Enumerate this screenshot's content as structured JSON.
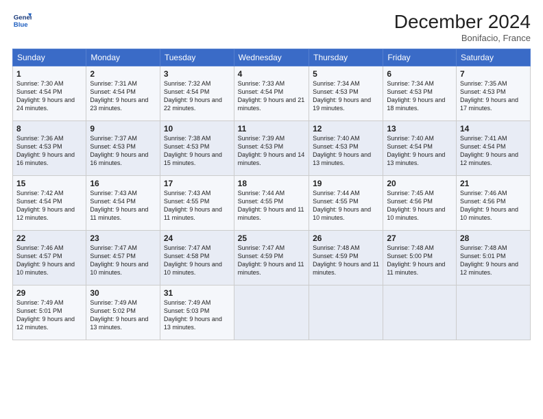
{
  "header": {
    "logo_line1": "General",
    "logo_line2": "Blue",
    "month_title": "December 2024",
    "location": "Bonifacio, France"
  },
  "weekdays": [
    "Sunday",
    "Monday",
    "Tuesday",
    "Wednesday",
    "Thursday",
    "Friday",
    "Saturday"
  ],
  "weeks": [
    [
      {
        "day": "1",
        "sunrise": "Sunrise: 7:30 AM",
        "sunset": "Sunset: 4:54 PM",
        "daylight": "Daylight: 9 hours and 24 minutes."
      },
      {
        "day": "2",
        "sunrise": "Sunrise: 7:31 AM",
        "sunset": "Sunset: 4:54 PM",
        "daylight": "Daylight: 9 hours and 23 minutes."
      },
      {
        "day": "3",
        "sunrise": "Sunrise: 7:32 AM",
        "sunset": "Sunset: 4:54 PM",
        "daylight": "Daylight: 9 hours and 22 minutes."
      },
      {
        "day": "4",
        "sunrise": "Sunrise: 7:33 AM",
        "sunset": "Sunset: 4:54 PM",
        "daylight": "Daylight: 9 hours and 21 minutes."
      },
      {
        "day": "5",
        "sunrise": "Sunrise: 7:34 AM",
        "sunset": "Sunset: 4:53 PM",
        "daylight": "Daylight: 9 hours and 19 minutes."
      },
      {
        "day": "6",
        "sunrise": "Sunrise: 7:34 AM",
        "sunset": "Sunset: 4:53 PM",
        "daylight": "Daylight: 9 hours and 18 minutes."
      },
      {
        "day": "7",
        "sunrise": "Sunrise: 7:35 AM",
        "sunset": "Sunset: 4:53 PM",
        "daylight": "Daylight: 9 hours and 17 minutes."
      }
    ],
    [
      {
        "day": "8",
        "sunrise": "Sunrise: 7:36 AM",
        "sunset": "Sunset: 4:53 PM",
        "daylight": "Daylight: 9 hours and 16 minutes."
      },
      {
        "day": "9",
        "sunrise": "Sunrise: 7:37 AM",
        "sunset": "Sunset: 4:53 PM",
        "daylight": "Daylight: 9 hours and 16 minutes."
      },
      {
        "day": "10",
        "sunrise": "Sunrise: 7:38 AM",
        "sunset": "Sunset: 4:53 PM",
        "daylight": "Daylight: 9 hours and 15 minutes."
      },
      {
        "day": "11",
        "sunrise": "Sunrise: 7:39 AM",
        "sunset": "Sunset: 4:53 PM",
        "daylight": "Daylight: 9 hours and 14 minutes."
      },
      {
        "day": "12",
        "sunrise": "Sunrise: 7:40 AM",
        "sunset": "Sunset: 4:53 PM",
        "daylight": "Daylight: 9 hours and 13 minutes."
      },
      {
        "day": "13",
        "sunrise": "Sunrise: 7:40 AM",
        "sunset": "Sunset: 4:54 PM",
        "daylight": "Daylight: 9 hours and 13 minutes."
      },
      {
        "day": "14",
        "sunrise": "Sunrise: 7:41 AM",
        "sunset": "Sunset: 4:54 PM",
        "daylight": "Daylight: 9 hours and 12 minutes."
      }
    ],
    [
      {
        "day": "15",
        "sunrise": "Sunrise: 7:42 AM",
        "sunset": "Sunset: 4:54 PM",
        "daylight": "Daylight: 9 hours and 12 minutes."
      },
      {
        "day": "16",
        "sunrise": "Sunrise: 7:43 AM",
        "sunset": "Sunset: 4:54 PM",
        "daylight": "Daylight: 9 hours and 11 minutes."
      },
      {
        "day": "17",
        "sunrise": "Sunrise: 7:43 AM",
        "sunset": "Sunset: 4:55 PM",
        "daylight": "Daylight: 9 hours and 11 minutes."
      },
      {
        "day": "18",
        "sunrise": "Sunrise: 7:44 AM",
        "sunset": "Sunset: 4:55 PM",
        "daylight": "Daylight: 9 hours and 11 minutes."
      },
      {
        "day": "19",
        "sunrise": "Sunrise: 7:44 AM",
        "sunset": "Sunset: 4:55 PM",
        "daylight": "Daylight: 9 hours and 10 minutes."
      },
      {
        "day": "20",
        "sunrise": "Sunrise: 7:45 AM",
        "sunset": "Sunset: 4:56 PM",
        "daylight": "Daylight: 9 hours and 10 minutes."
      },
      {
        "day": "21",
        "sunrise": "Sunrise: 7:46 AM",
        "sunset": "Sunset: 4:56 PM",
        "daylight": "Daylight: 9 hours and 10 minutes."
      }
    ],
    [
      {
        "day": "22",
        "sunrise": "Sunrise: 7:46 AM",
        "sunset": "Sunset: 4:57 PM",
        "daylight": "Daylight: 9 hours and 10 minutes."
      },
      {
        "day": "23",
        "sunrise": "Sunrise: 7:47 AM",
        "sunset": "Sunset: 4:57 PM",
        "daylight": "Daylight: 9 hours and 10 minutes."
      },
      {
        "day": "24",
        "sunrise": "Sunrise: 7:47 AM",
        "sunset": "Sunset: 4:58 PM",
        "daylight": "Daylight: 9 hours and 10 minutes."
      },
      {
        "day": "25",
        "sunrise": "Sunrise: 7:47 AM",
        "sunset": "Sunset: 4:59 PM",
        "daylight": "Daylight: 9 hours and 11 minutes."
      },
      {
        "day": "26",
        "sunrise": "Sunrise: 7:48 AM",
        "sunset": "Sunset: 4:59 PM",
        "daylight": "Daylight: 9 hours and 11 minutes."
      },
      {
        "day": "27",
        "sunrise": "Sunrise: 7:48 AM",
        "sunset": "Sunset: 5:00 PM",
        "daylight": "Daylight: 9 hours and 11 minutes."
      },
      {
        "day": "28",
        "sunrise": "Sunrise: 7:48 AM",
        "sunset": "Sunset: 5:01 PM",
        "daylight": "Daylight: 9 hours and 12 minutes."
      }
    ],
    [
      {
        "day": "29",
        "sunrise": "Sunrise: 7:49 AM",
        "sunset": "Sunset: 5:01 PM",
        "daylight": "Daylight: 9 hours and 12 minutes."
      },
      {
        "day": "30",
        "sunrise": "Sunrise: 7:49 AM",
        "sunset": "Sunset: 5:02 PM",
        "daylight": "Daylight: 9 hours and 13 minutes."
      },
      {
        "day": "31",
        "sunrise": "Sunrise: 7:49 AM",
        "sunset": "Sunset: 5:03 PM",
        "daylight": "Daylight: 9 hours and 13 minutes."
      },
      null,
      null,
      null,
      null
    ]
  ]
}
